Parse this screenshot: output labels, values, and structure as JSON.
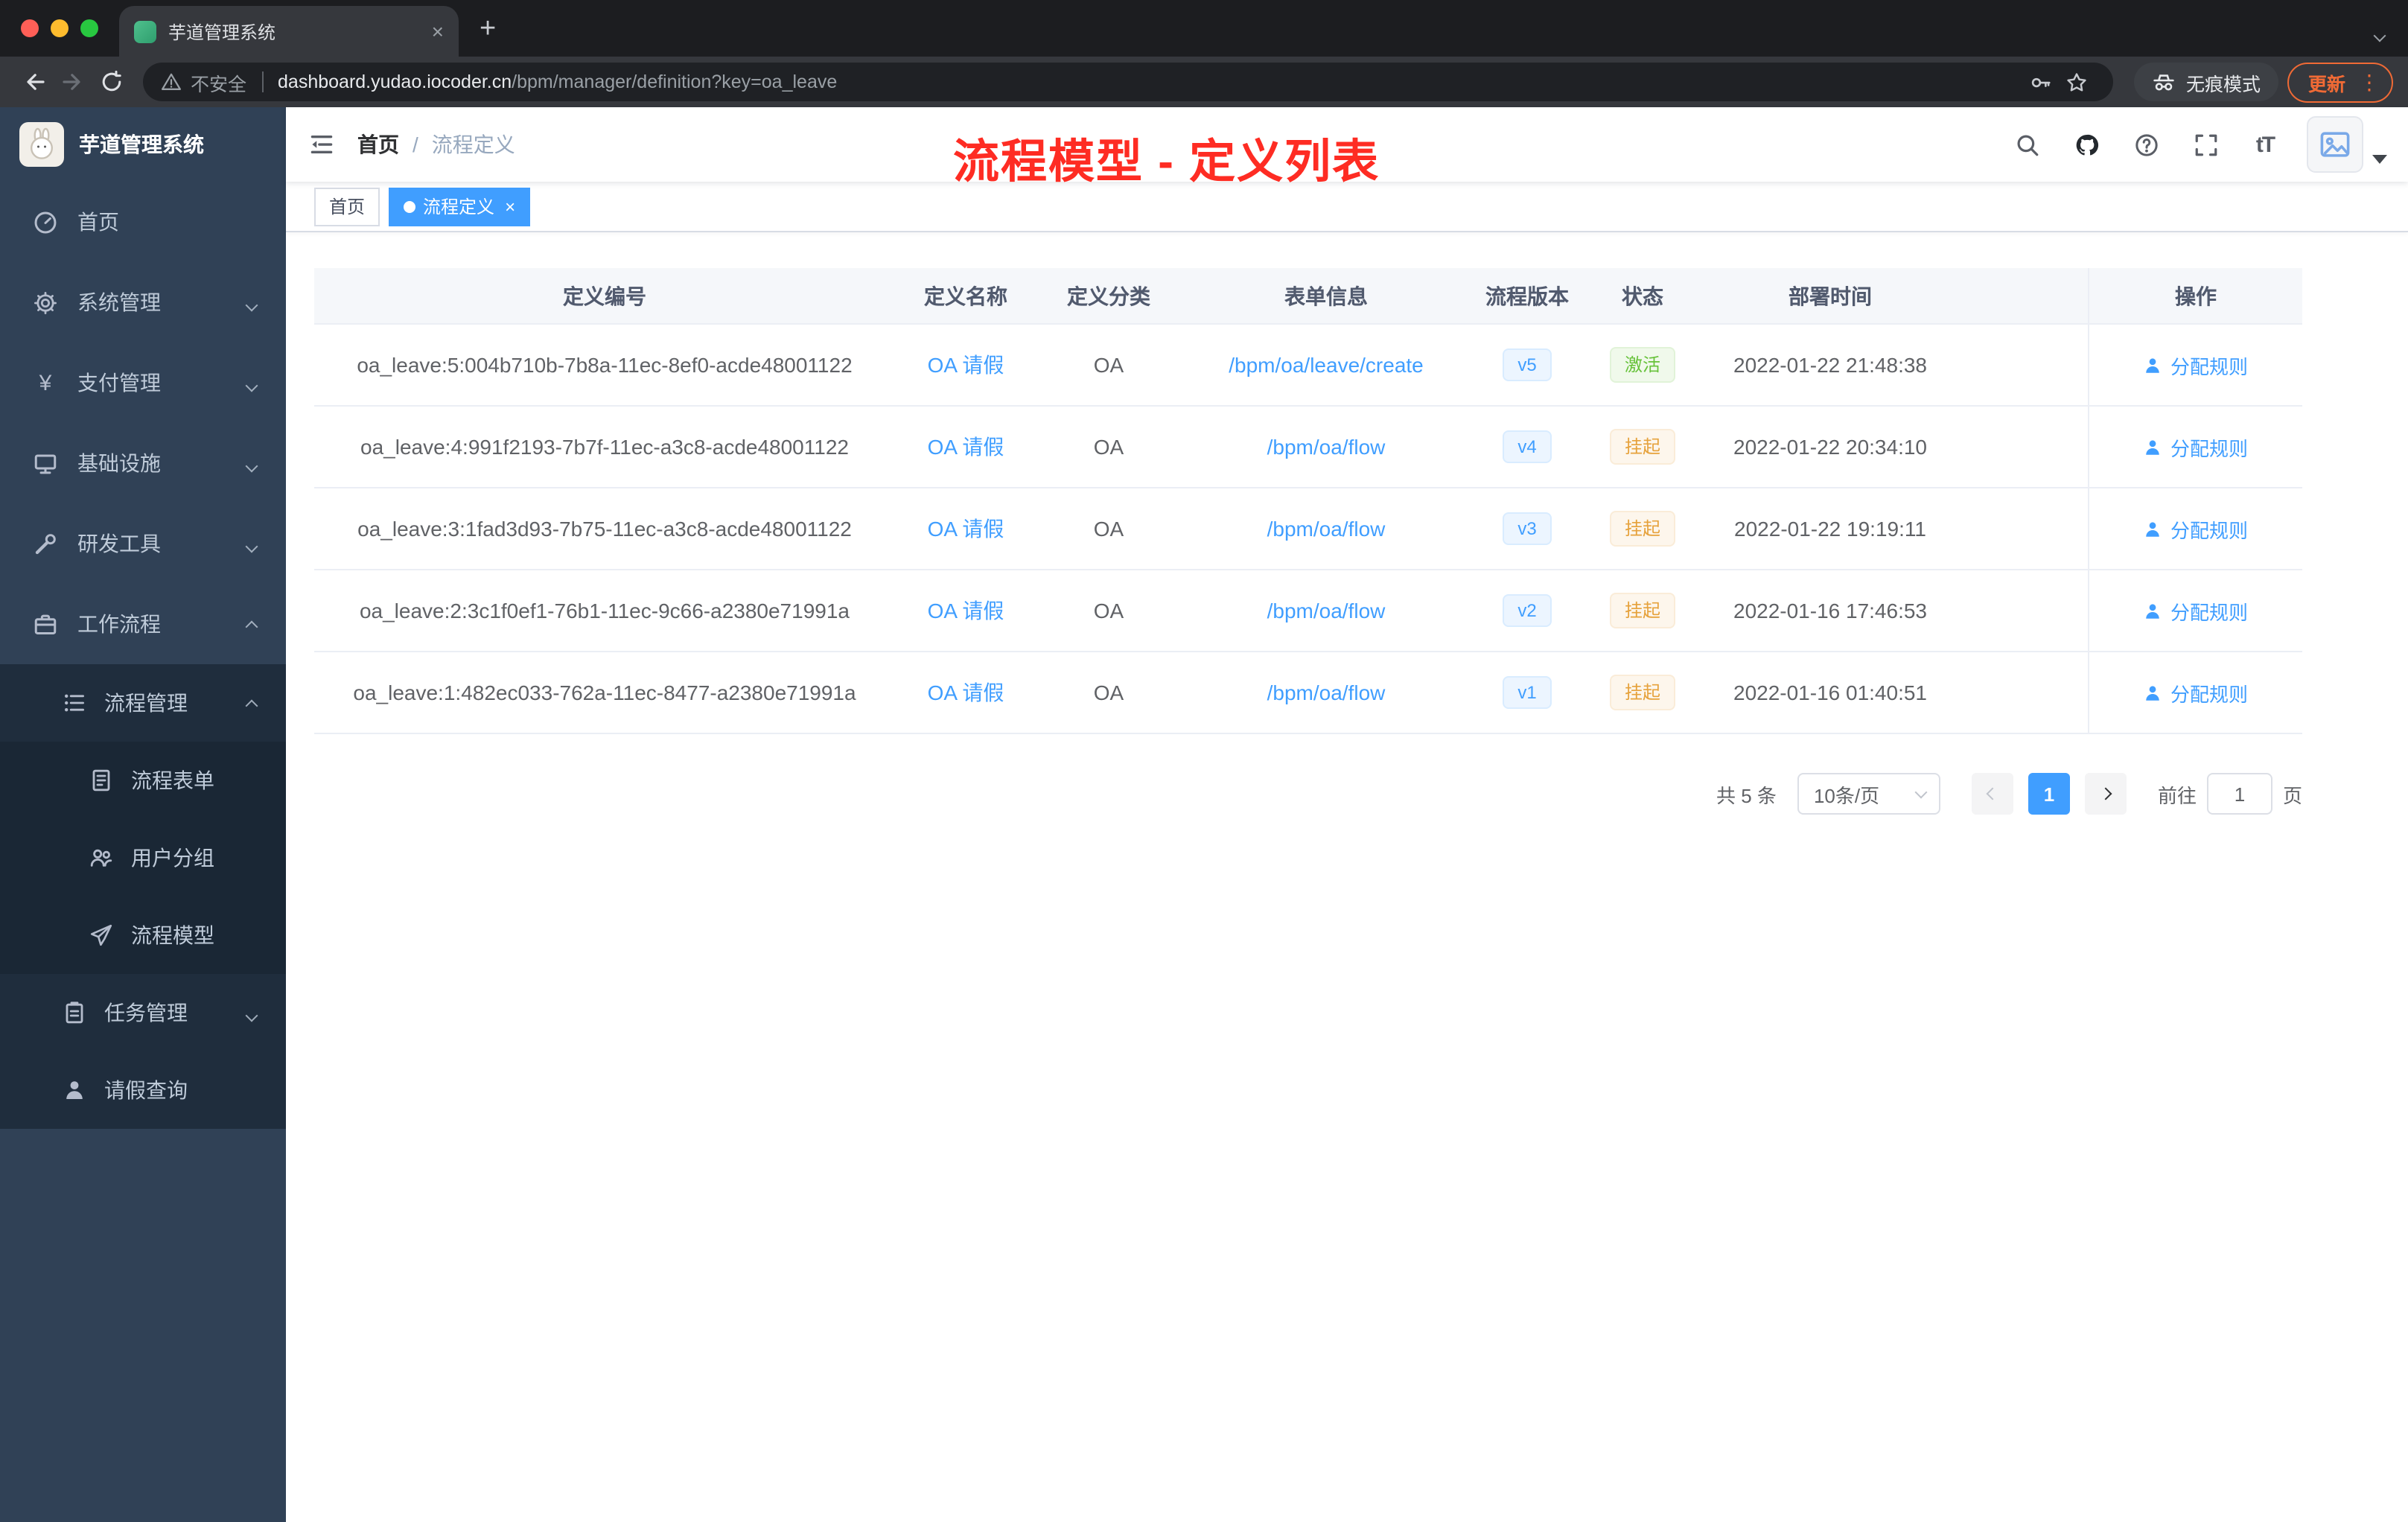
{
  "colors": {
    "accent": "#409eff",
    "annotation_red": "#fe2c23",
    "status_active_green": "#67c23a",
    "status_suspended_orange": "#e6a23c",
    "sidebar_bg": "#304156",
    "update_orange": "#f06a35"
  },
  "glyphs": {
    "close": "×",
    "plus": "+",
    "kebab": "⋮",
    "yen": "¥",
    "font_size": "tT"
  },
  "browser": {
    "tab_title": "芋道管理系统",
    "security_label": "不安全",
    "url_domain": "dashboard.yudao.iocoder.cn",
    "url_path": "/bpm/manager/definition?key=oa_leave",
    "incognito_label": "无痕模式",
    "update_label": "更新"
  },
  "sidebar": {
    "logo_title": "芋道管理系统",
    "items": [
      {
        "label": "首页"
      },
      {
        "label": "系统管理"
      },
      {
        "label": "支付管理"
      },
      {
        "label": "基础设施"
      },
      {
        "label": "研发工具"
      },
      {
        "label": "工作流程"
      }
    ],
    "submenu": {
      "label": "流程管理",
      "children": [
        "流程表单",
        "用户分组",
        "流程模型"
      ],
      "task_label": "任务管理",
      "leave_label": "请假查询"
    }
  },
  "navbar": {
    "breadcrumb": [
      "首页",
      "流程定义"
    ],
    "separator": "/",
    "annotation": "流程模型 - 定义列表"
  },
  "tags": {
    "items": [
      {
        "label": "首页",
        "active": false
      },
      {
        "label": "流程定义",
        "active": true
      }
    ]
  },
  "table": {
    "columns": [
      "定义编号",
      "定义名称",
      "定义分类",
      "表单信息",
      "流程版本",
      "状态",
      "部署时间",
      "操作"
    ],
    "rows": [
      {
        "id": "oa_leave:5:004b710b-7b8a-11ec-8ef0-acde48001122",
        "name": "OA 请假",
        "category": "OA",
        "form": "/bpm/oa/leave/create",
        "version": "v5",
        "status": "激活",
        "deploy_time": "2022-01-22 21:48:38",
        "action": "分配规则"
      },
      {
        "id": "oa_leave:4:991f2193-7b7f-11ec-a3c8-acde48001122",
        "name": "OA 请假",
        "category": "OA",
        "form": "/bpm/oa/flow",
        "version": "v4",
        "status": "挂起",
        "deploy_time": "2022-01-22 20:34:10",
        "action": "分配规则"
      },
      {
        "id": "oa_leave:3:1fad3d93-7b75-11ec-a3c8-acde48001122",
        "name": "OA 请假",
        "category": "OA",
        "form": "/bpm/oa/flow",
        "version": "v3",
        "status": "挂起",
        "deploy_time": "2022-01-22 19:19:11",
        "action": "分配规则"
      },
      {
        "id": "oa_leave:2:3c1f0ef1-76b1-11ec-9c66-a2380e71991a",
        "name": "OA 请假",
        "category": "OA",
        "form": "/bpm/oa/flow",
        "version": "v2",
        "status": "挂起",
        "deploy_time": "2022-01-16 17:46:53",
        "action": "分配规则"
      },
      {
        "id": "oa_leave:1:482ec033-762a-11ec-8477-a2380e71991a",
        "name": "OA 请假",
        "category": "OA",
        "form": "/bpm/oa/flow",
        "version": "v1",
        "status": "挂起",
        "deploy_time": "2022-01-16 01:40:51",
        "action": "分配规则"
      }
    ]
  },
  "pagination": {
    "total": "共 5 条",
    "page_size": "10条/页",
    "page": "1",
    "goto": "前往",
    "goto_value": "1",
    "unit": "页"
  }
}
